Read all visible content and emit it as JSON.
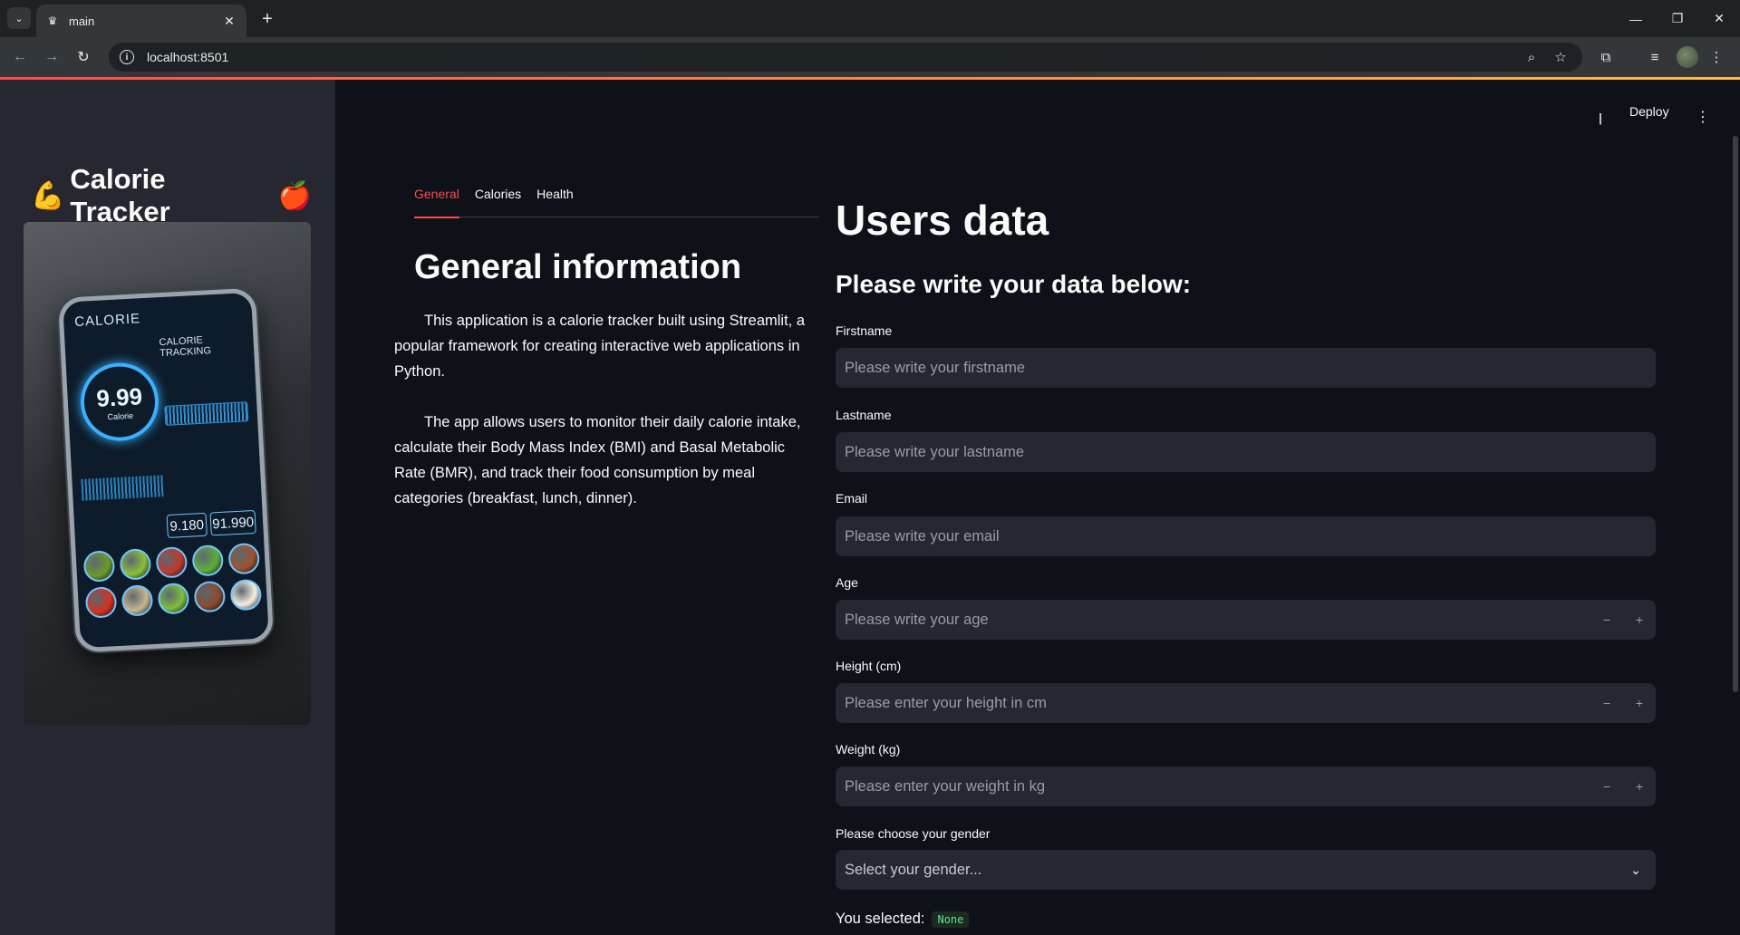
{
  "browser": {
    "tab_title": "main",
    "url": "localhost:8501"
  },
  "sidebar": {
    "title": "Calorie Tracker",
    "title_emoji_left": "💪",
    "title_emoji_right": "🍎",
    "image": {
      "screen_title": "CALORIE",
      "screen_subtitle": "CALORIE TRACKING",
      "main_number": "9.99",
      "main_number_unit": "Calorie",
      "readout_left": "9.180",
      "readout_right": "91.990",
      "food_colors": [
        "#6b9a2c",
        "#8bbf3a",
        "#c0392b",
        "#5fae3a",
        "#a0522d",
        "#d6301f",
        "#c7b78f",
        "#7fbf3a",
        "#8b4a2b",
        "#f5f0e0"
      ]
    }
  },
  "header": {
    "deploy_label": "Deploy"
  },
  "tabs": {
    "general": "General",
    "calories": "Calories",
    "health": "Health"
  },
  "general": {
    "title": "General information",
    "paragraph1": "This application is a calorie tracker built using Streamlit, a popular framework for creating interactive web applications in Python.",
    "paragraph2": "The app allows users to monitor their daily calorie intake, calculate their Body Mass Index (BMI) and Basal Metabolic Rate (BMR), and track their food consumption by meal categories (breakfast, lunch, dinner)."
  },
  "form": {
    "title": "Users data",
    "subtitle": "Please write your data below:",
    "firstname": {
      "label": "Firstname",
      "placeholder": "Please write your firstname"
    },
    "lastname": {
      "label": "Lastname",
      "placeholder": "Please write your lastname"
    },
    "email": {
      "label": "Email",
      "placeholder": "Please write your email"
    },
    "age": {
      "label": "Age",
      "placeholder": "Please write your age"
    },
    "height": {
      "label": "Height (cm)",
      "placeholder": "Please enter your height in cm"
    },
    "weight": {
      "label": "Weight (kg)",
      "placeholder": "Please enter your weight in kg"
    },
    "gender": {
      "label": "Please choose your gender",
      "value": "Select your gender..."
    },
    "selected_label": "You selected:",
    "selected_value": "None"
  },
  "colors": {
    "accent": "#ff4b4b",
    "background": "#0e1117",
    "sidebar": "#262730",
    "code_green": "#5ce488"
  }
}
